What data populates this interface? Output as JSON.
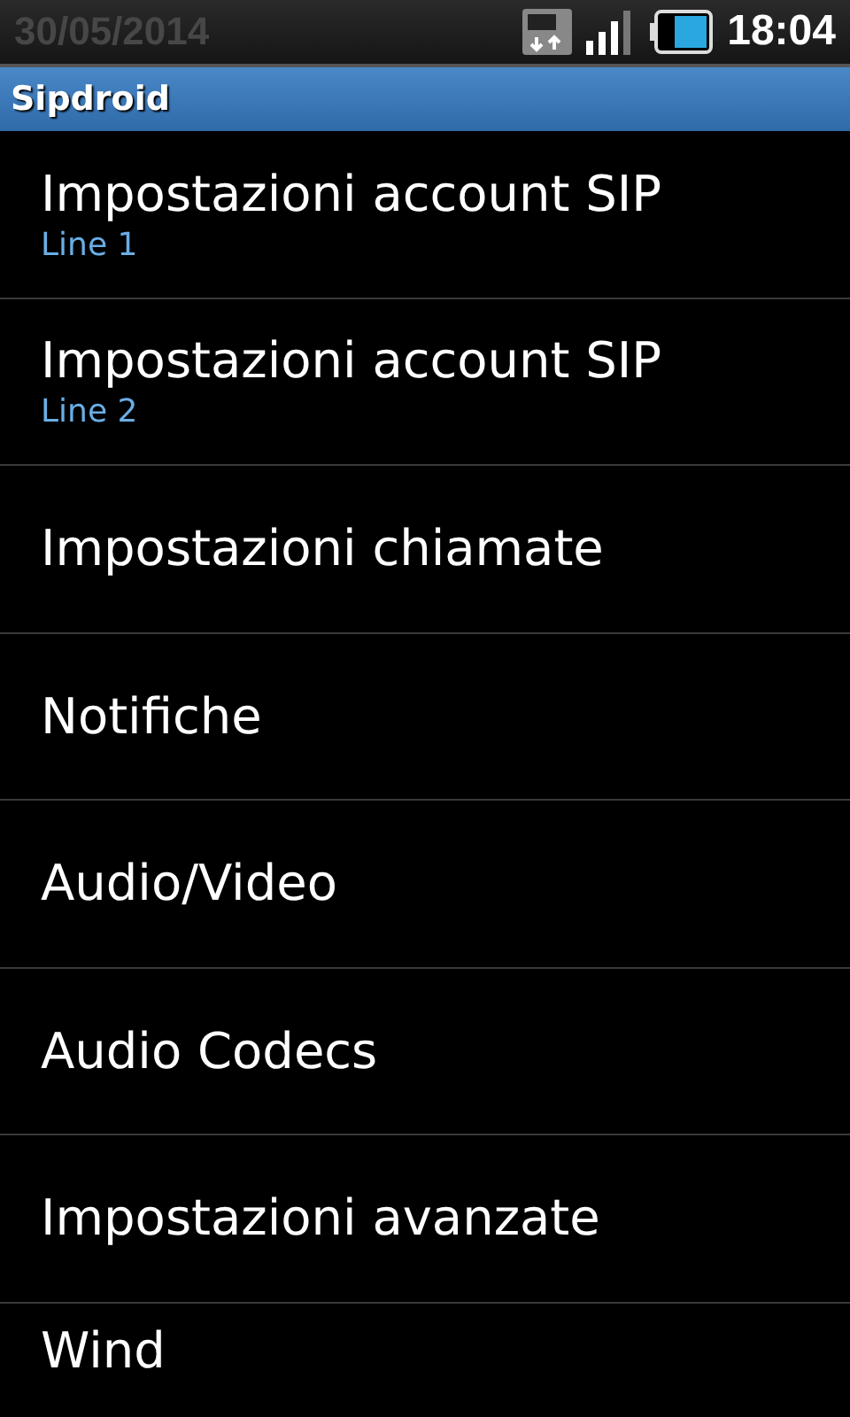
{
  "status_bar": {
    "date": "30/05/2014",
    "time": "18:04"
  },
  "title_bar": {
    "title": "Sipdroid"
  },
  "settings": [
    {
      "title": "Impostazioni account SIP",
      "summary": "Line 1"
    },
    {
      "title": "Impostazioni account SIP",
      "summary": "Line 2"
    },
    {
      "title": "Impostazioni chiamate"
    },
    {
      "title": "Notifiche"
    },
    {
      "title": "Audio/Video"
    },
    {
      "title": "Audio Codecs"
    },
    {
      "title": "Impostazioni avanzate"
    },
    {
      "title": "Wind"
    }
  ]
}
